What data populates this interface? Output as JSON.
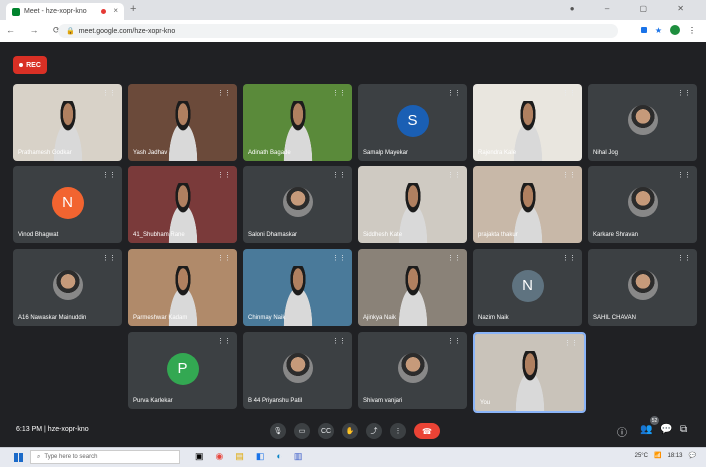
{
  "browser": {
    "tab_title": "Meet - hze-xopr-kno",
    "url": "meet.google.com/hze-xopr-kno",
    "close_glyph": "×",
    "newtab_glyph": "+"
  },
  "meet": {
    "rec_label": "REC",
    "meeting_time": "6:13 PM",
    "meeting_code": "hze-xopr-kno",
    "participant_count": "52",
    "tiles": [
      {
        "name": "Prathamesh Godkar",
        "kind": "video",
        "bg": "#d8d2c8"
      },
      {
        "name": "Yash Jadhav",
        "kind": "video",
        "bg": "#6b4a3a"
      },
      {
        "name": "Adinath Bagade",
        "kind": "video",
        "bg": "#5a8a3a"
      },
      {
        "name": "Samalp Mayekar",
        "kind": "letter",
        "letter": "S",
        "color": "#1a5fb4"
      },
      {
        "name": "Rajendra Kale",
        "kind": "video",
        "bg": "#e9e6df"
      },
      {
        "name": "Nihal Jog",
        "kind": "photo"
      },
      {
        "name": "Vinod Bhagwat",
        "kind": "letter",
        "letter": "N",
        "color": "#f26430"
      },
      {
        "name": "41_Shubham Rane",
        "kind": "video",
        "bg": "#7a3a3a"
      },
      {
        "name": "Saloni Dhamaskar",
        "kind": "photo"
      },
      {
        "name": "Siddhesh Kate",
        "kind": "video",
        "bg": "#cfcac2"
      },
      {
        "name": "prajakta thakur",
        "kind": "video",
        "bg": "#c8b8a8"
      },
      {
        "name": "Karkare Shravan",
        "kind": "photo"
      },
      {
        "name": "A16 Nawaskar Mainuddin",
        "kind": "photo"
      },
      {
        "name": "Parmeshwar Kadam",
        "kind": "video",
        "bg": "#b08a6a"
      },
      {
        "name": "Chinmay Naik",
        "kind": "video",
        "bg": "#4a7a9a"
      },
      {
        "name": "Ajinkya Naik",
        "kind": "video",
        "bg": "#8a8278"
      },
      {
        "name": "Nazim Naik",
        "kind": "letter",
        "letter": "N",
        "color": "#5f7380"
      },
      {
        "name": "SAHIL CHAVAN",
        "kind": "photo"
      },
      {
        "name": "Purva Karlekar",
        "kind": "letter",
        "letter": "P",
        "color": "#33a852"
      },
      {
        "name": "B 44 Priyanshu Patil",
        "kind": "photo"
      },
      {
        "name": "Shivam vanjari",
        "kind": "photo"
      },
      {
        "name": "You",
        "kind": "video",
        "bg": "#c9c3ba"
      }
    ]
  },
  "taskbar": {
    "search_placeholder": "Type here to search",
    "weather": "25°C",
    "clock": "18:13"
  }
}
